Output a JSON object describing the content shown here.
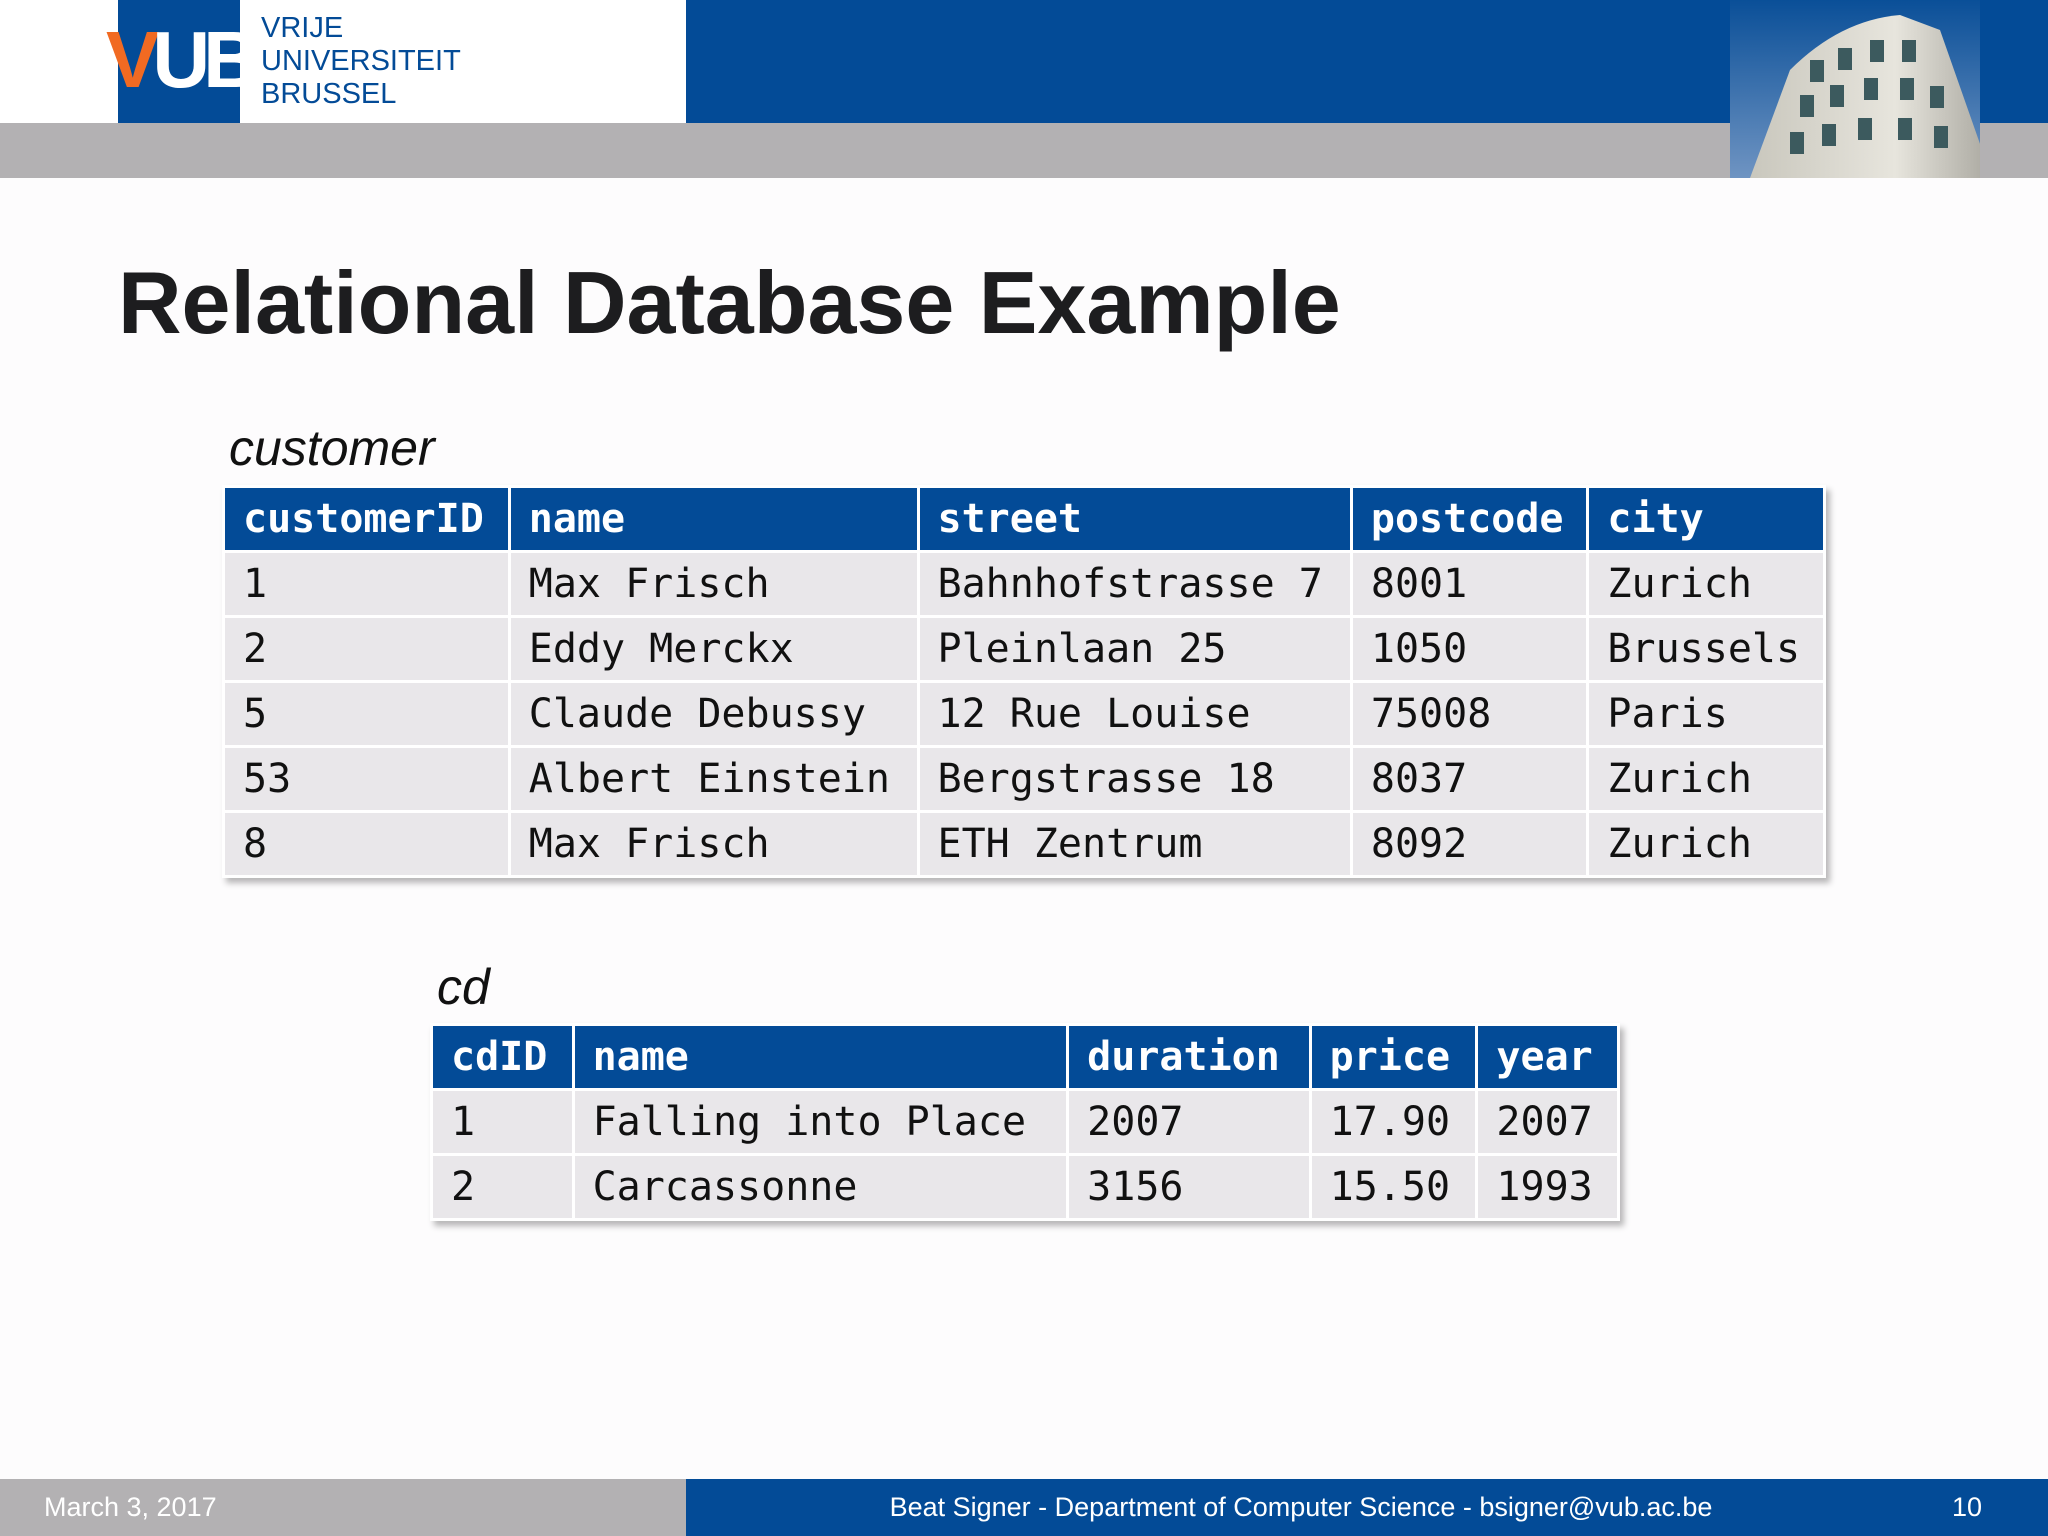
{
  "header": {
    "logo_letters": {
      "v": "V",
      "ub": "UB"
    },
    "institution_lines": [
      "VRIJE",
      "UNIVERSITEIT",
      "BRUSSEL"
    ]
  },
  "slide": {
    "title": "Relational Database Example"
  },
  "customer_table": {
    "caption": "customer",
    "columns": [
      "customerID",
      "name",
      "street",
      "postcode",
      "city"
    ],
    "rows": [
      [
        "1",
        "Max Frisch",
        "Bahnhofstrasse 7",
        "8001",
        "Zurich"
      ],
      [
        "2",
        "Eddy Merckx",
        "Pleinlaan 25",
        "1050",
        "Brussels"
      ],
      [
        "5",
        "Claude Debussy",
        "12 Rue Louise",
        "75008",
        "Paris"
      ],
      [
        "53",
        "Albert Einstein",
        "Bergstrasse 18",
        "8037",
        "Zurich"
      ],
      [
        "8",
        "Max Frisch",
        "ETH Zentrum",
        "8092",
        "Zurich"
      ]
    ]
  },
  "cd_table": {
    "caption": "cd",
    "columns": [
      "cdID",
      "name",
      "duration",
      "price",
      "year"
    ],
    "rows": [
      [
        "1",
        "Falling into Place",
        "2007",
        "17.90",
        "2007"
      ],
      [
        "2",
        "Carcassonne",
        "3156",
        "15.50",
        "1993"
      ]
    ]
  },
  "footer": {
    "date": "March 3, 2017",
    "author": "Beat Signer - Department of Computer Science - bsigner@vub.ac.be",
    "page_number": "10"
  },
  "colors": {
    "brand_blue": "#034b97",
    "brand_orange": "#f16a22",
    "band_grey": "#b3b1b3",
    "cell_grey": "#e9e7ea"
  }
}
